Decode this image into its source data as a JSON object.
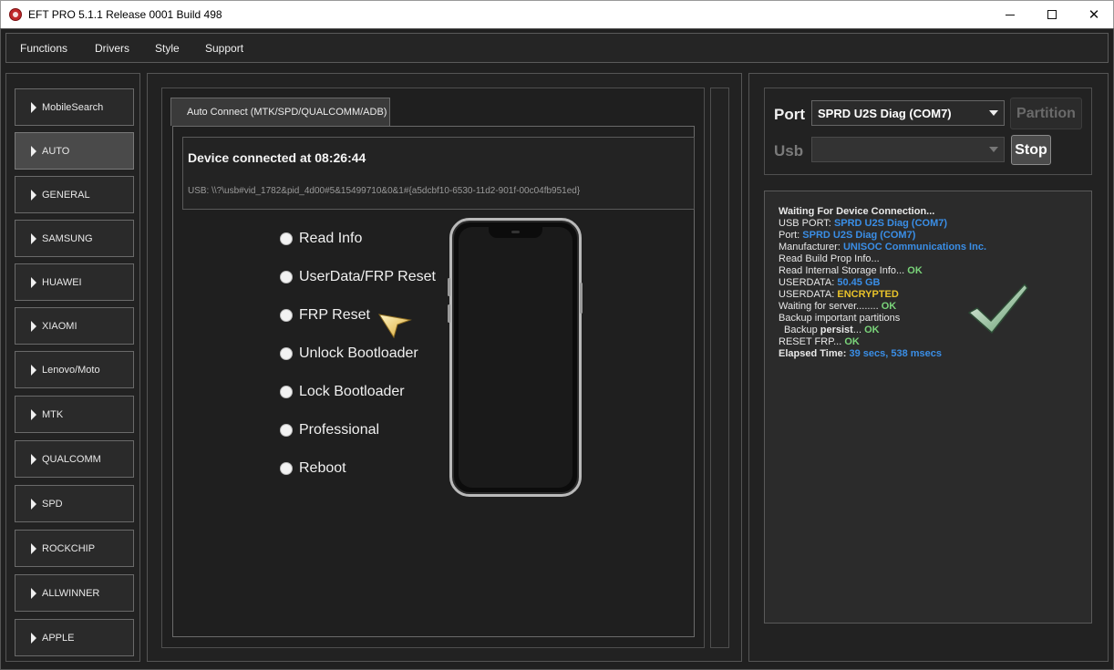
{
  "window": {
    "title": "EFT PRO 5.1.1 Release 0001 Build 498",
    "controls": [
      "minimize-icon",
      "maximize-icon",
      "close-icon"
    ]
  },
  "menu": [
    "Functions",
    "Drivers",
    "Style",
    "Support"
  ],
  "sidebar": {
    "items": [
      "MobileSearch",
      "AUTO",
      "GENERAL",
      "SAMSUNG",
      "HUAWEI",
      "XIAOMI",
      "Lenovo/Moto",
      "MTK",
      "QUALCOMM",
      "SPD",
      "ROCKCHIP",
      "ALLWINNER",
      "APPLE"
    ],
    "active": "AUTO"
  },
  "main": {
    "tab_label": "Auto Connect (MTK/SPD/QUALCOMM/ADB)",
    "device_title": "Device connected at 08:26:44",
    "usb_path": "USB: \\\\?\\usb#vid_1782&pid_4d00#5&15499710&0&1#{a5dcbf10-6530-11d2-901f-00c04fb951ed}",
    "options": [
      "Read Info",
      "UserData/FRP Reset",
      "FRP Reset",
      "Unlock Bootloader",
      "Lock Bootloader",
      "Professional",
      "Reboot"
    ],
    "selected_option": null
  },
  "connection": {
    "port_label": "Port",
    "port_value": "SPRD U2S Diag (COM7)",
    "usb_label": "Usb",
    "usb_value": "",
    "partition_button": "Partition",
    "stop_button": "Stop"
  },
  "log": {
    "waiting": "Waiting For Device Connection...",
    "usb_port_label": "USB PORT:",
    "usb_port_value": "SPRD U2S Diag (COM7)",
    "port_label": "Port:",
    "port_value": "SPRD U2S Diag (COM7)",
    "manufacturer_label": "Manufacturer:",
    "manufacturer_value": "UNISOC Communications Inc.",
    "read_build": "Read Build Prop Info...",
    "read_storage": "Read Internal Storage Info...",
    "read_storage_status": "OK",
    "userdata_label_1": "USERDATA:",
    "userdata_size": "50.45 GB",
    "userdata_label_2": "USERDATA:",
    "userdata_state": "ENCRYPTED",
    "waiting_server": "Waiting for server........",
    "waiting_server_status": "OK",
    "backup_partitions": "Backup important partitions",
    "backup_prefix": "Backup",
    "backup_name": "persist",
    "backup_suffix": "...",
    "backup_status": "OK",
    "reset_frp": "RESET FRP...",
    "reset_frp_status": "OK",
    "elapsed_label": "Elapsed Time:",
    "elapsed_value": "39 secs, 538 msecs"
  },
  "colors": {
    "accent_blue": "#3a8ee6",
    "ok_green": "#7ad47a",
    "warn_yellow": "#e8c22a",
    "background": "#1e1e1e"
  }
}
